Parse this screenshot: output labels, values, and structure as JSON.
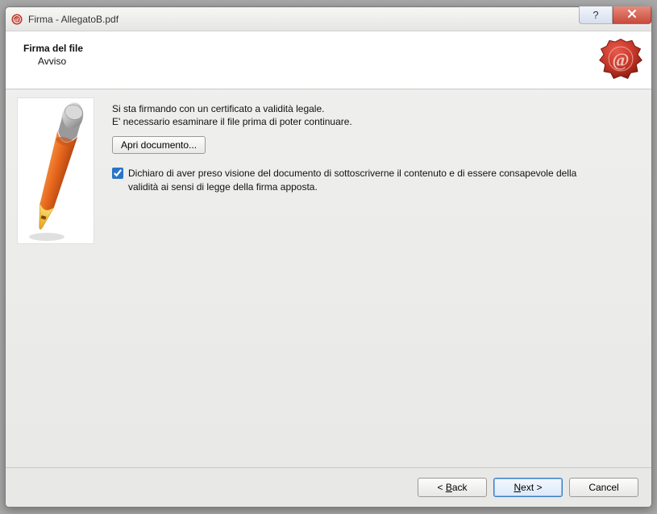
{
  "window": {
    "title": "Firma - AllegatoB.pdf"
  },
  "header": {
    "title": "Firma del file",
    "subtitle": "Avviso"
  },
  "content": {
    "line1": "Si sta firmando con un certificato a validità legale.",
    "line2": "E' necessario esaminare il file prima di poter continuare.",
    "open_doc_label": "Apri documento...",
    "consent_checked": true,
    "consent_text": "Dichiaro di aver preso visione del documento di sottoscriverne il contenuto e di essere consapevole della validità ai sensi di legge della firma apposta."
  },
  "footer": {
    "back_prefix": "< ",
    "back_accel": "B",
    "back_rest": "ack",
    "next_accel": "N",
    "next_rest": "ext >",
    "cancel": "Cancel"
  },
  "icons": {
    "app": "seal-at-icon",
    "help": "?",
    "close": "close-icon",
    "seal": "wax-seal-at-icon",
    "pen": "orange-pen-icon"
  }
}
